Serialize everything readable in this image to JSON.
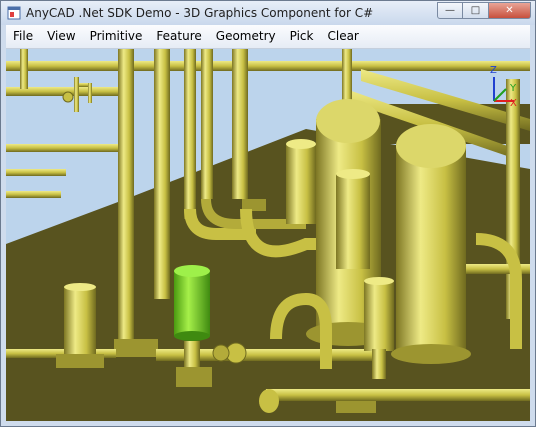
{
  "window": {
    "title": "AnyCAD .Net SDK Demo - 3D Graphics Component for C#",
    "buttons": {
      "minimize": "—",
      "maximize": "□",
      "close": "✕"
    }
  },
  "menu": {
    "items": [
      {
        "label": "File"
      },
      {
        "label": "View"
      },
      {
        "label": "Primitive"
      },
      {
        "label": "Feature"
      },
      {
        "label": "Geometry"
      },
      {
        "label": "Pick"
      },
      {
        "label": "Clear"
      }
    ]
  },
  "viewport": {
    "axes": {
      "x": "X",
      "y": "Y",
      "z": "Z"
    },
    "colors": {
      "sky": "#bcd4ec",
      "floor": "#58531f",
      "pipe": "#c8c044",
      "pipe_light": "#eeea86",
      "pipe_dark": "#7d7623",
      "selected": "#7ed321",
      "axis_x": "#e02020",
      "axis_y": "#20a020",
      "axis_z": "#2040d0"
    }
  }
}
